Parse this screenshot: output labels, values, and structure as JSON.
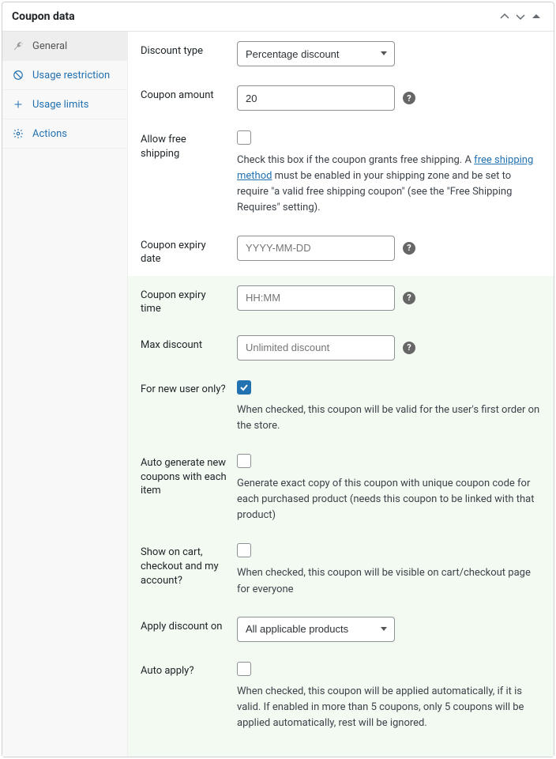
{
  "panel": {
    "title": "Coupon data"
  },
  "tabs": [
    {
      "id": "general",
      "label": "General"
    },
    {
      "id": "usage-restriction",
      "label": "Usage restriction"
    },
    {
      "id": "usage-limits",
      "label": "Usage limits"
    },
    {
      "id": "actions",
      "label": "Actions"
    }
  ],
  "activeTab": "general",
  "fields": {
    "discount_type": {
      "label": "Discount type",
      "value": "Percentage discount"
    },
    "coupon_amount": {
      "label": "Coupon amount",
      "value": "20"
    },
    "free_shipping": {
      "label": "Allow free shipping",
      "checked": false,
      "desc_pre": "Check this box if the coupon grants free shipping. A ",
      "link_text": "free shipping method",
      "desc_post": " must be enabled in your shipping zone and be set to require \"a valid free shipping coupon\" (see the \"Free Shipping Requires\" setting)."
    },
    "expiry_date": {
      "label": "Coupon expiry date",
      "placeholder": "YYYY-MM-DD",
      "value": ""
    },
    "expiry_time": {
      "label": "Coupon expiry time",
      "placeholder": "HH:MM",
      "value": ""
    },
    "max_discount": {
      "label": "Max discount",
      "placeholder": "Unlimited discount",
      "value": ""
    },
    "new_user": {
      "label": "For new user only?",
      "checked": true,
      "desc": "When checked, this coupon will be valid for the user's first order on the store."
    },
    "auto_generate": {
      "label": "Auto generate new coupons with each item",
      "checked": false,
      "desc": "Generate exact copy of this coupon with unique coupon code for each purchased product (needs this coupon to be linked with that product)"
    },
    "show_on_cart": {
      "label": "Show on cart, checkout and my account?",
      "checked": false,
      "desc": "When checked, this coupon will be visible on cart/checkout page for everyone"
    },
    "apply_on": {
      "label": "Apply discount on",
      "value": "All applicable products"
    },
    "auto_apply": {
      "label": "Auto apply?",
      "checked": false,
      "desc": "When checked, this coupon will be applied automatically, if it is valid. If enabled in more than 5 coupons, only 5 coupons will be applied automatically, rest will be ignored."
    }
  }
}
